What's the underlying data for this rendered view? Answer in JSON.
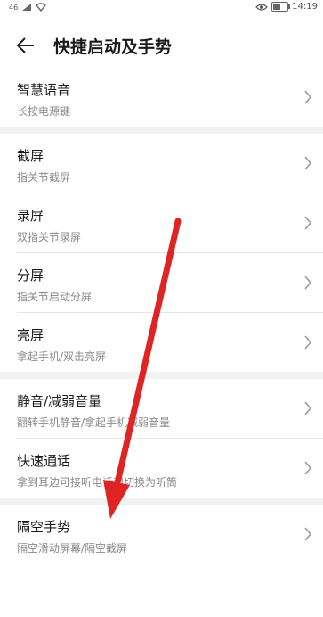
{
  "status": {
    "signal": "46",
    "time": "14:19",
    "battery_level": 0.55
  },
  "header": {
    "title": "快捷启动及手势"
  },
  "groups": [
    {
      "items": [
        {
          "title": "智慧语音",
          "subtitle": "长按电源键"
        }
      ]
    },
    {
      "items": [
        {
          "title": "截屏",
          "subtitle": "指关节截屏"
        },
        {
          "title": "录屏",
          "subtitle": "双指关节录屏"
        },
        {
          "title": "分屏",
          "subtitle": "指关节启动分屏"
        },
        {
          "title": "亮屏",
          "subtitle": "拿起手机/双击亮屏"
        }
      ]
    },
    {
      "items": [
        {
          "title": "静音/减弱音量",
          "subtitle": "翻转手机静音/拿起手机减弱音量"
        },
        {
          "title": "快速通话",
          "subtitle": "拿到耳边可接听电话和切换为听筒"
        }
      ]
    },
    {
      "items": [
        {
          "title": "隔空手势",
          "subtitle": "隔空滑动屏幕/隔空截屏"
        }
      ]
    }
  ],
  "colors": {
    "annotation_arrow": "#e02424"
  }
}
